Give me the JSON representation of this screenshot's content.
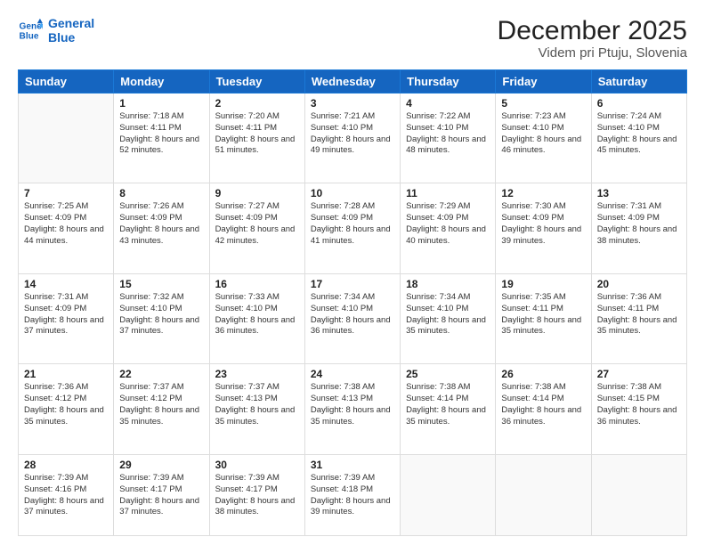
{
  "header": {
    "logo_line1": "General",
    "logo_line2": "Blue",
    "title": "December 2025",
    "subtitle": "Videm pri Ptuju, Slovenia"
  },
  "weekdays": [
    "Sunday",
    "Monday",
    "Tuesday",
    "Wednesday",
    "Thursday",
    "Friday",
    "Saturday"
  ],
  "weeks": [
    [
      {
        "day": "",
        "sunrise": "",
        "sunset": "",
        "daylight": ""
      },
      {
        "day": "1",
        "sunrise": "Sunrise: 7:18 AM",
        "sunset": "Sunset: 4:11 PM",
        "daylight": "Daylight: 8 hours and 52 minutes."
      },
      {
        "day": "2",
        "sunrise": "Sunrise: 7:20 AM",
        "sunset": "Sunset: 4:11 PM",
        "daylight": "Daylight: 8 hours and 51 minutes."
      },
      {
        "day": "3",
        "sunrise": "Sunrise: 7:21 AM",
        "sunset": "Sunset: 4:10 PM",
        "daylight": "Daylight: 8 hours and 49 minutes."
      },
      {
        "day": "4",
        "sunrise": "Sunrise: 7:22 AM",
        "sunset": "Sunset: 4:10 PM",
        "daylight": "Daylight: 8 hours and 48 minutes."
      },
      {
        "day": "5",
        "sunrise": "Sunrise: 7:23 AM",
        "sunset": "Sunset: 4:10 PM",
        "daylight": "Daylight: 8 hours and 46 minutes."
      },
      {
        "day": "6",
        "sunrise": "Sunrise: 7:24 AM",
        "sunset": "Sunset: 4:10 PM",
        "daylight": "Daylight: 8 hours and 45 minutes."
      }
    ],
    [
      {
        "day": "7",
        "sunrise": "Sunrise: 7:25 AM",
        "sunset": "Sunset: 4:09 PM",
        "daylight": "Daylight: 8 hours and 44 minutes."
      },
      {
        "day": "8",
        "sunrise": "Sunrise: 7:26 AM",
        "sunset": "Sunset: 4:09 PM",
        "daylight": "Daylight: 8 hours and 43 minutes."
      },
      {
        "day": "9",
        "sunrise": "Sunrise: 7:27 AM",
        "sunset": "Sunset: 4:09 PM",
        "daylight": "Daylight: 8 hours and 42 minutes."
      },
      {
        "day": "10",
        "sunrise": "Sunrise: 7:28 AM",
        "sunset": "Sunset: 4:09 PM",
        "daylight": "Daylight: 8 hours and 41 minutes."
      },
      {
        "day": "11",
        "sunrise": "Sunrise: 7:29 AM",
        "sunset": "Sunset: 4:09 PM",
        "daylight": "Daylight: 8 hours and 40 minutes."
      },
      {
        "day": "12",
        "sunrise": "Sunrise: 7:30 AM",
        "sunset": "Sunset: 4:09 PM",
        "daylight": "Daylight: 8 hours and 39 minutes."
      },
      {
        "day": "13",
        "sunrise": "Sunrise: 7:31 AM",
        "sunset": "Sunset: 4:09 PM",
        "daylight": "Daylight: 8 hours and 38 minutes."
      }
    ],
    [
      {
        "day": "14",
        "sunrise": "Sunrise: 7:31 AM",
        "sunset": "Sunset: 4:09 PM",
        "daylight": "Daylight: 8 hours and 37 minutes."
      },
      {
        "day": "15",
        "sunrise": "Sunrise: 7:32 AM",
        "sunset": "Sunset: 4:10 PM",
        "daylight": "Daylight: 8 hours and 37 minutes."
      },
      {
        "day": "16",
        "sunrise": "Sunrise: 7:33 AM",
        "sunset": "Sunset: 4:10 PM",
        "daylight": "Daylight: 8 hours and 36 minutes."
      },
      {
        "day": "17",
        "sunrise": "Sunrise: 7:34 AM",
        "sunset": "Sunset: 4:10 PM",
        "daylight": "Daylight: 8 hours and 36 minutes."
      },
      {
        "day": "18",
        "sunrise": "Sunrise: 7:34 AM",
        "sunset": "Sunset: 4:10 PM",
        "daylight": "Daylight: 8 hours and 35 minutes."
      },
      {
        "day": "19",
        "sunrise": "Sunrise: 7:35 AM",
        "sunset": "Sunset: 4:11 PM",
        "daylight": "Daylight: 8 hours and 35 minutes."
      },
      {
        "day": "20",
        "sunrise": "Sunrise: 7:36 AM",
        "sunset": "Sunset: 4:11 PM",
        "daylight": "Daylight: 8 hours and 35 minutes."
      }
    ],
    [
      {
        "day": "21",
        "sunrise": "Sunrise: 7:36 AM",
        "sunset": "Sunset: 4:12 PM",
        "daylight": "Daylight: 8 hours and 35 minutes."
      },
      {
        "day": "22",
        "sunrise": "Sunrise: 7:37 AM",
        "sunset": "Sunset: 4:12 PM",
        "daylight": "Daylight: 8 hours and 35 minutes."
      },
      {
        "day": "23",
        "sunrise": "Sunrise: 7:37 AM",
        "sunset": "Sunset: 4:13 PM",
        "daylight": "Daylight: 8 hours and 35 minutes."
      },
      {
        "day": "24",
        "sunrise": "Sunrise: 7:38 AM",
        "sunset": "Sunset: 4:13 PM",
        "daylight": "Daylight: 8 hours and 35 minutes."
      },
      {
        "day": "25",
        "sunrise": "Sunrise: 7:38 AM",
        "sunset": "Sunset: 4:14 PM",
        "daylight": "Daylight: 8 hours and 35 minutes."
      },
      {
        "day": "26",
        "sunrise": "Sunrise: 7:38 AM",
        "sunset": "Sunset: 4:14 PM",
        "daylight": "Daylight: 8 hours and 36 minutes."
      },
      {
        "day": "27",
        "sunrise": "Sunrise: 7:38 AM",
        "sunset": "Sunset: 4:15 PM",
        "daylight": "Daylight: 8 hours and 36 minutes."
      }
    ],
    [
      {
        "day": "28",
        "sunrise": "Sunrise: 7:39 AM",
        "sunset": "Sunset: 4:16 PM",
        "daylight": "Daylight: 8 hours and 37 minutes."
      },
      {
        "day": "29",
        "sunrise": "Sunrise: 7:39 AM",
        "sunset": "Sunset: 4:17 PM",
        "daylight": "Daylight: 8 hours and 37 minutes."
      },
      {
        "day": "30",
        "sunrise": "Sunrise: 7:39 AM",
        "sunset": "Sunset: 4:17 PM",
        "daylight": "Daylight: 8 hours and 38 minutes."
      },
      {
        "day": "31",
        "sunrise": "Sunrise: 7:39 AM",
        "sunset": "Sunset: 4:18 PM",
        "daylight": "Daylight: 8 hours and 39 minutes."
      },
      {
        "day": "",
        "sunrise": "",
        "sunset": "",
        "daylight": ""
      },
      {
        "day": "",
        "sunrise": "",
        "sunset": "",
        "daylight": ""
      },
      {
        "day": "",
        "sunrise": "",
        "sunset": "",
        "daylight": ""
      }
    ]
  ]
}
